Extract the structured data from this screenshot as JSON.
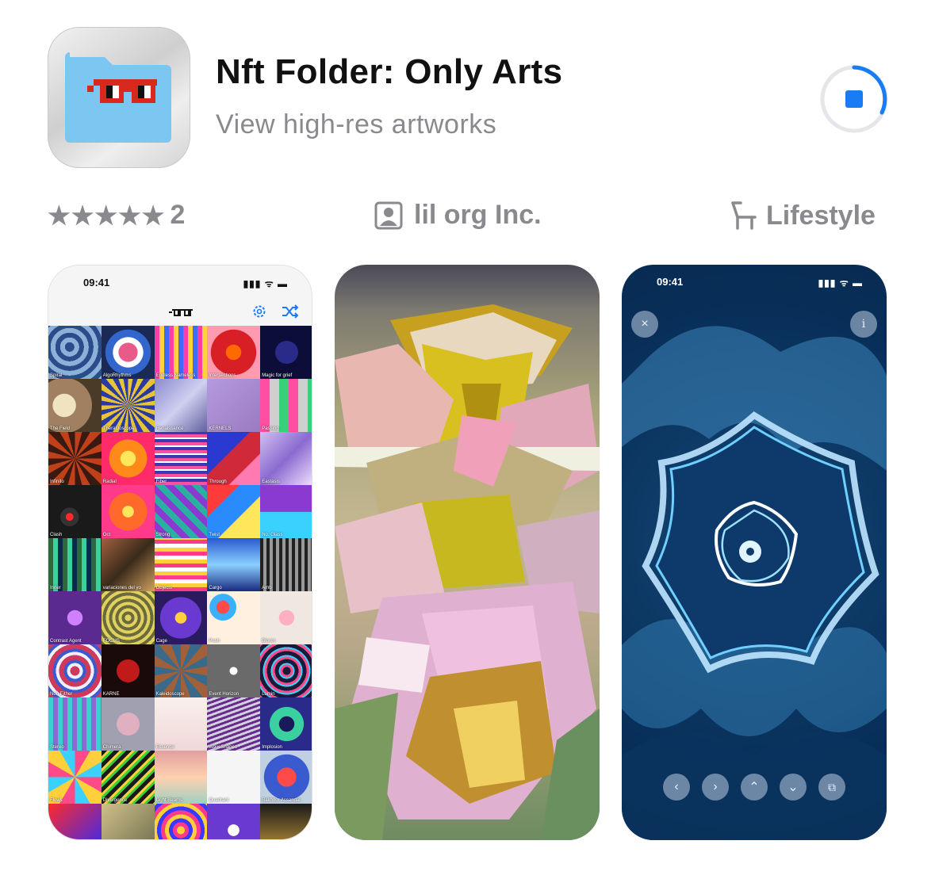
{
  "app": {
    "title": "Nft Folder: Only Arts",
    "subtitle": "View high-res artworks",
    "icon": "glasses-folder-icon",
    "accent_color": "#1a7cf5"
  },
  "meta": {
    "rating_stars": "★★★★★",
    "rating_count": "2",
    "developer": "lil org Inc.",
    "category": "Lifestyle"
  },
  "screenshots": {
    "shot1": {
      "time": "09:41",
      "status_icons": "▮▮▮ ᯤ ▬",
      "tiles": [
        {
          "label": "Spiral",
          "bg": "repeating-radial-gradient(circle at 40% 40%,#2b4c8a 0 6px,#8db0d9 6px 12px)"
        },
        {
          "label": "AlgoRhythms",
          "bg": "radial-gradient(circle,#e85a8a 0 25%,#ffffff 26% 40%,#3366cc 41% 60%,#1a2a55 61%)"
        },
        {
          "label": "Endless Nameless",
          "bg": "repeating-linear-gradient(90deg,#ff3ea5 0 6px,#ffd13b 6px 12px,#3b6cff 12px 18px)"
        },
        {
          "label": "Intersections",
          "bg": "radial-gradient(circle,#ff6a00 0 20%,#d81f26 21% 60%,#ff9bb0 61%)"
        },
        {
          "label": "Magic for grief",
          "bg": "radial-gradient(circle,#2a2a8a 0 30%,#0d0d3a 31%)"
        },
        {
          "label": "The Field",
          "bg": "radial-gradient(circle at 30% 50%,#f0e4c0 0 25%,#a08060 26% 60%,#4a3a28 61%)"
        },
        {
          "label": "Theraldoscope",
          "bg": "repeating-conic-gradient(#e7c33a 0 10deg,#2a3aa0 10deg 20deg)"
        },
        {
          "label": "Renaissance",
          "bg": "linear-gradient(135deg,#8a8ad0,#d0d0f0,#6060a0)"
        },
        {
          "label": "KERNELS",
          "bg": "linear-gradient(135deg,#b59adf,#9a7ac0)"
        },
        {
          "label": "Passing",
          "bg": "repeating-linear-gradient(90deg,#ff4fa3 0 12px,#cfcfcf 12px 24px,#3ad07a 24px 36px)"
        },
        {
          "label": "Infinito",
          "bg": "repeating-conic-gradient(#c0401a 0 15deg,#3a1a10 15deg 30deg)"
        },
        {
          "label": "Radial",
          "bg": "radial-gradient(circle,#ffe65a 0 20%,#ff8a1a 21% 50%,#ff2a6a 51%)"
        },
        {
          "label": "Fiber",
          "bg": "repeating-linear-gradient(0deg,#ff4fa3 0 4px,#3a3ab0 4px 8px,#ffffff 8px 10px)"
        },
        {
          "label": "Through",
          "bg": "linear-gradient(135deg,#2a3ad0 0 40%,#d02a3a 41% 70%,#ff7ab0 71%)"
        },
        {
          "label": "Eastasis",
          "bg": "linear-gradient(135deg,#d0c0f0,#8a6ad0,#f0e0ff)"
        },
        {
          "label": "Clash",
          "bg": "radial-gradient(circle at 40% 60%,#ff2a2a 0 8%,#333 9% 20%,#1a1a1a 21%)"
        },
        {
          "label": "Oct",
          "bg": "radial-gradient(circle,#ffe65a 0 15%,#ff6a2a 16% 50%,#ff3a8a 51%)"
        },
        {
          "label": "Strong",
          "bg": "repeating-linear-gradient(45deg,#2ab0a0 0 8px,#8a3ad0 8px 16px)"
        },
        {
          "label": "Twist",
          "bg": "linear-gradient(135deg,#ff3a3a 0 30%,#2a8aff 31% 60%,#ffe65a 61%)"
        },
        {
          "label": "No. Glass",
          "bg": "linear-gradient(180deg,#8a3ad0 0 50%,#3ad0ff 51%)"
        },
        {
          "label": "Inner",
          "bg": "repeating-linear-gradient(90deg,#2a6a3a 0 6px,#3ad0a0 6px 12px,#0a2a4a 12px 18px)"
        },
        {
          "label": "variaciones del yo",
          "bg": "linear-gradient(135deg,#a06040,#3a2a1a,#d0a060)"
        },
        {
          "label": "Objects",
          "bg": "repeating-linear-gradient(0deg,#ff3a8a 0 5px,#ffd03a 5px 10px,#ffffff 10px 15px)"
        },
        {
          "label": "Cargo",
          "bg": "linear-gradient(180deg,#2a5ad0,#8ad0ff,#1a2a80)"
        },
        {
          "label": "Amb",
          "bg": "repeating-linear-gradient(90deg,#222 0 4px,#999 4px 8px)"
        },
        {
          "label": "Contrast Agent",
          "bg": "radial-gradient(circle,#d080ff 0 20%,#5a2a90 21%)"
        },
        {
          "label": "FOCUS",
          "bg": "repeating-radial-gradient(circle,#e0d060 0 4px,#6a6a3a 4px 8px)"
        },
        {
          "label": "Cage",
          "bg": "radial-gradient(circle,#ffd03a 0 15%,#6a3ad0 16% 55%,#2a1a60 56%)"
        },
        {
          "label": "Push",
          "bg": "radial-gradient(circle at 30% 30%,#ff4a4a 0 12%,#3ab0ff 13% 25%,#fff0e0 26%)"
        },
        {
          "label": "Bloom",
          "bg": "radial-gradient(circle,#ffb0c0 0 20%,#f0e8e0 21%)"
        },
        {
          "label": "Non Either",
          "bg": "repeating-radial-gradient(circle,#d03a5a 0 6px,#f0f0ff 6px 10px,#3a5ad0 10px 14px)"
        },
        {
          "label": "KARNE",
          "bg": "radial-gradient(circle,#c01a1a 0 30%,#1a0a0a 31%)"
        },
        {
          "label": "Kaleidoscope",
          "bg": "repeating-conic-gradient(#a0603a 0 20deg,#3a6a8a 20deg 40deg)"
        },
        {
          "label": "Event Horizon",
          "bg": "radial-gradient(circle,#ffffff 0 10%,#6a6a6a 11%)"
        },
        {
          "label": "Lumin",
          "bg": "repeating-radial-gradient(circle,#1a1a3a 0 5px,#ff4a8a 5px 8px,#3ad0ff 8px 10px)"
        },
        {
          "label": "Stereo",
          "bg": "repeating-linear-gradient(90deg,#3ad0d0 0 6px,#8a6ad0 6px 12px)"
        },
        {
          "label": "Chimera",
          "bg": "radial-gradient(circle,#e0b0c0 0 30%,#a0a0b0 31%)"
        },
        {
          "label": "Essence",
          "bg": "linear-gradient(180deg,#f8f0ec,#f0d8d8)"
        },
        {
          "label": "WaveShapes",
          "bg": "repeating-linear-gradient(160deg,#6a2a8a 0 3px,#d0d0e0 3px 6px)"
        },
        {
          "label": "Implosion",
          "bg": "radial-gradient(circle,#1a1a5a 0 20%,#3ad0a0 21% 45%,#2a2a8a 46%)"
        },
        {
          "label": "Flows",
          "bg": "repeating-conic-gradient(#ff4a8a 0 30deg,#ffd03a 30deg 60deg,#3ad0ff 60deg 90deg)"
        },
        {
          "label": "Divergence",
          "bg": "repeating-linear-gradient(135deg,#1a1a1a 0 5px,#ffd03a 5px 8px,#3ad03a 8px 11px)"
        },
        {
          "label": "Light Beams",
          "bg": "linear-gradient(180deg,#e0a0a0,#ffd0b0,#a0d0c0)"
        },
        {
          "label": "Quadrant",
          "bg": "repeating-radial-gradient(square,#ff8aa0 0 5px,#d0b0ff 5px 10px)"
        },
        {
          "label": "Bakhoor Assandal",
          "bg": "radial-gradient(circle,#ff4a4a 0 25%,#3a5ad0 26% 60%,#c0d0e0 61%)"
        },
        {
          "label": "",
          "bg": "linear-gradient(135deg,#ff2a2a,#2a2aff)"
        },
        {
          "label": "",
          "bg": "linear-gradient(135deg,#d0c08a,#6a6a4a)"
        },
        {
          "label": "",
          "bg": "repeating-radial-gradient(circle,#ffd03a 0 5px,#ff3a8a 5px 10px,#3a3aff 10px 15px)"
        },
        {
          "label": "",
          "bg": "radial-gradient(circle,#ffffff 0 15%,#6a3ad0 16%)"
        },
        {
          "label": "",
          "bg": "linear-gradient(180deg,#1a1a1a,#d0a03a)"
        }
      ]
    },
    "shot3": {
      "time": "09:41",
      "status_icons": "▮▮▮ ᯤ ▬",
      "close_icon": "×",
      "info_icon": "i",
      "nav_buttons": [
        "‹",
        "›",
        "⌃",
        "⌄",
        "⧉"
      ]
    }
  }
}
